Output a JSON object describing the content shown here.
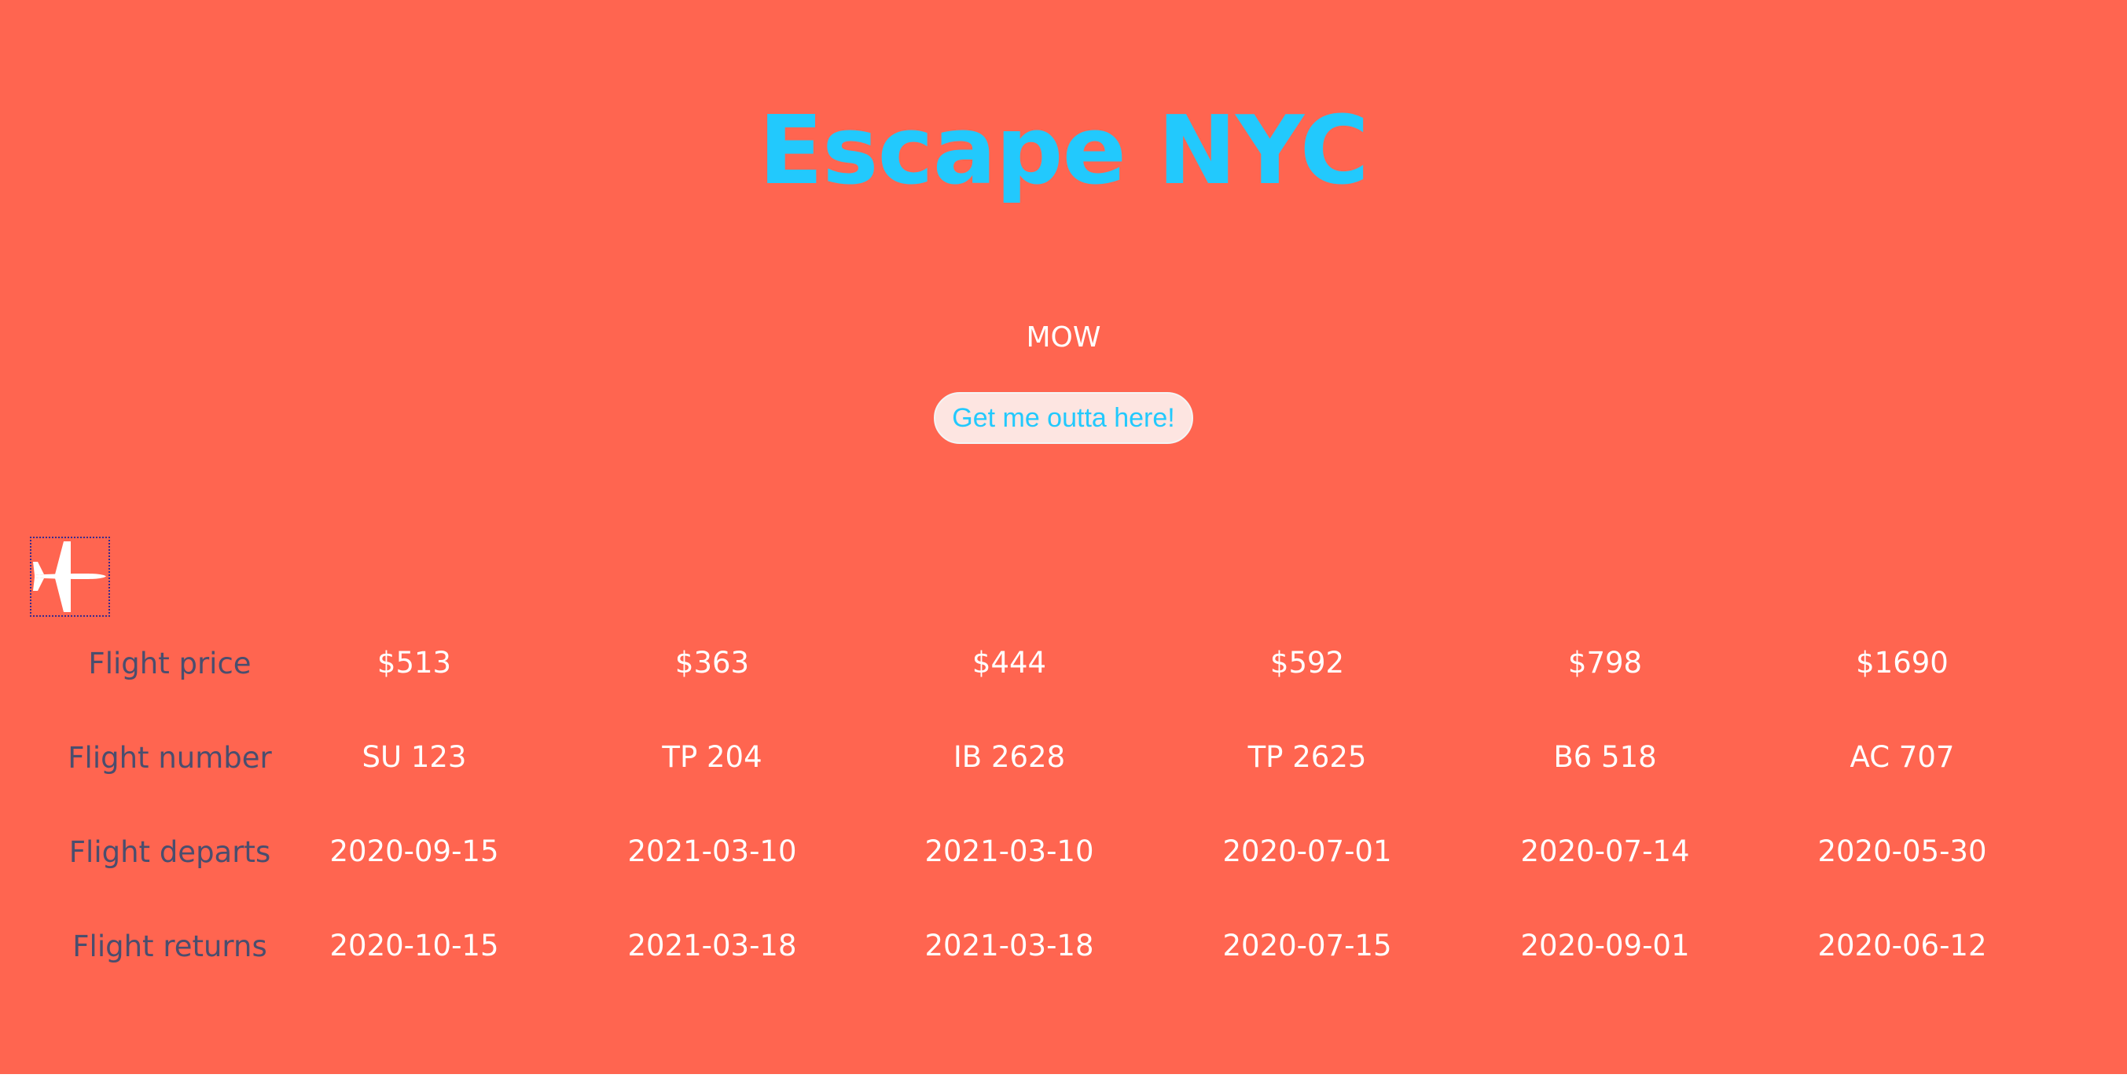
{
  "app": {
    "title": "Escape NYC",
    "origin_code": "MOW",
    "button_label": "Get me outta here!",
    "plane_icon": "airplane-icon"
  },
  "colors": {
    "background": "#ff6550",
    "title": "#22c9fd",
    "label_text": "#4a4e6e",
    "value_text": "#ffffff",
    "button_bg": "#fde5e1",
    "button_text": "#22c9fd"
  },
  "flights": {
    "row_labels": {
      "price": "Flight price",
      "number": "Flight number",
      "departs": "Flight departs",
      "returns": "Flight returns"
    },
    "columns": [
      {
        "price": "$513",
        "number": "SU 123",
        "departs": "2020-09-15",
        "returns": "2020-10-15"
      },
      {
        "price": "$363",
        "number": "TP 204",
        "departs": "2021-03-10",
        "returns": "2021-03-18"
      },
      {
        "price": "$444",
        "number": "IB 2628",
        "departs": "2021-03-10",
        "returns": "2021-03-18"
      },
      {
        "price": "$592",
        "number": "TP 2625",
        "departs": "2020-07-01",
        "returns": "2020-07-15"
      },
      {
        "price": "$798",
        "number": "B6 518",
        "departs": "2020-07-14",
        "returns": "2020-09-01"
      },
      {
        "price": "$1690",
        "number": "AC 707",
        "departs": "2020-05-30",
        "returns": "2020-06-12"
      }
    ]
  }
}
